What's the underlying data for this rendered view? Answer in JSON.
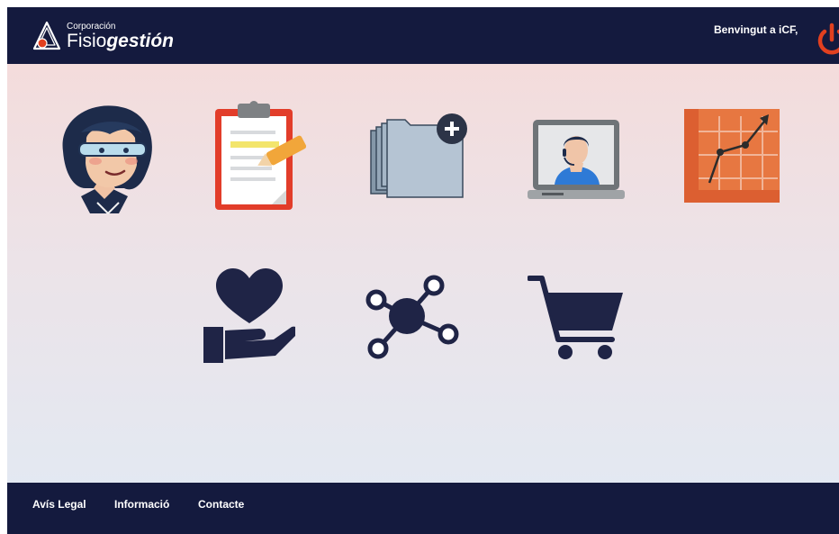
{
  "header": {
    "logo_small": "Corporación",
    "logo_part1": "Fisio",
    "logo_part2": "gestión",
    "welcome": "Benvingut a iCF,",
    "power_icon": "power-icon"
  },
  "menu_tiles": [
    {
      "icon": "user-profile-icon"
    },
    {
      "icon": "clipboard-icon"
    },
    {
      "icon": "folders-add-icon"
    },
    {
      "icon": "video-call-icon"
    },
    {
      "icon": "chart-icon"
    },
    {
      "icon": "heart-hand-icon"
    },
    {
      "icon": "network-icon"
    },
    {
      "icon": "shopping-cart-icon"
    }
  ],
  "footer": {
    "legal": "Avís Legal",
    "info": "Informació",
    "contact": "Contacte"
  },
  "colors": {
    "header_bg": "#141a3e",
    "accent": "#e2401f",
    "gradient_top": "#f6dad8",
    "gradient_bottom": "#e1eaf4"
  }
}
